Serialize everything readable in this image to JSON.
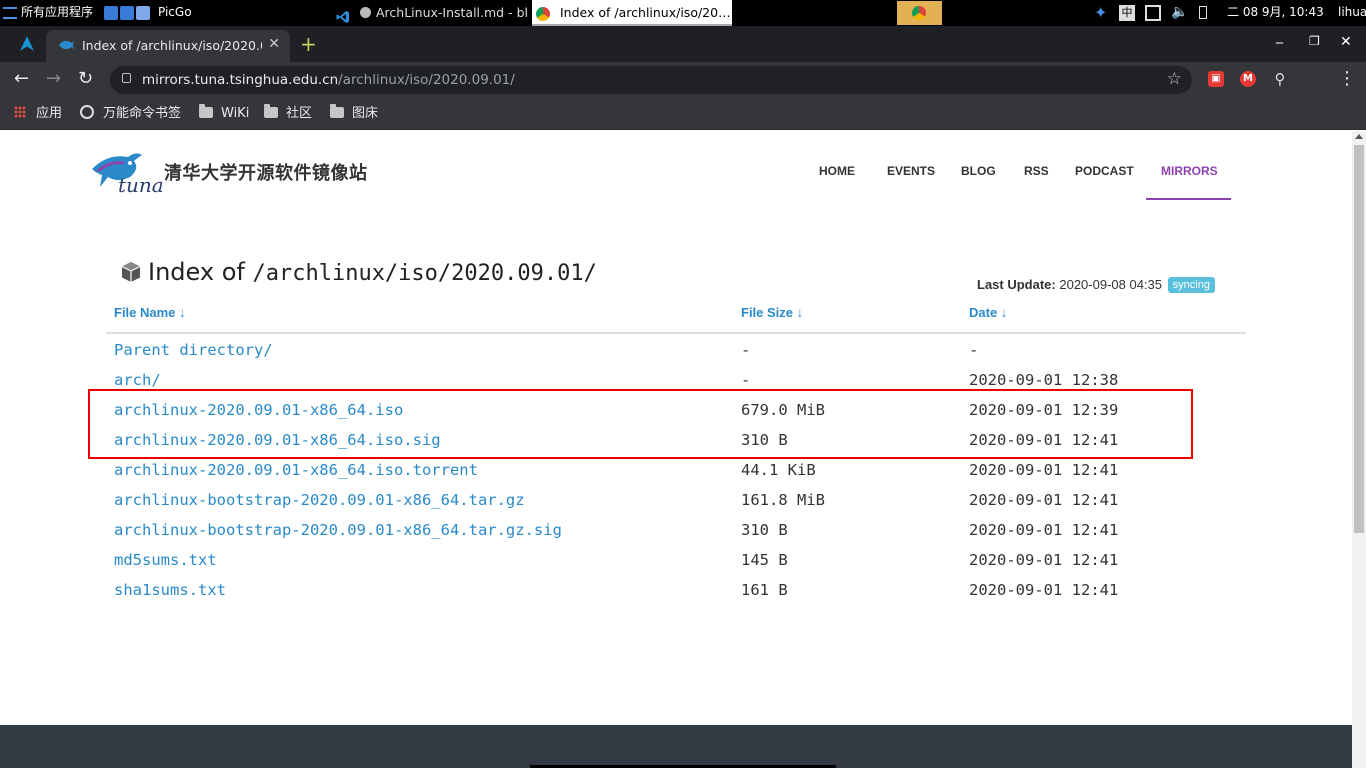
{
  "taskbar": {
    "apps_menu": "所有应用程序",
    "picgo": "PicGo",
    "task_vscode": "ArchLinux-Install.md - bl…",
    "task_chrome": "Index of /archlinux/iso/20…",
    "clock": "二 08 9月, 10:43",
    "user": "lihua"
  },
  "browser": {
    "tab_title": "Index of /archlinux/iso/2020.0",
    "url_host": "mirrors.tuna.tsinghua.edu.cn",
    "url_path": "/archlinux/iso/2020.09.01/",
    "bookmarks": [
      "应用",
      "万能命令书签",
      "WiKi",
      "社区",
      "图床"
    ]
  },
  "site": {
    "brand": "清华大学开源软件镜像站",
    "logo_text": "tuna",
    "menu": [
      "HOME",
      "EVENTS",
      "BLOG",
      "RSS",
      "PODCAST",
      "MIRRORS"
    ],
    "active_menu": "MIRRORS"
  },
  "index": {
    "title_prefix": "Index of",
    "title_path": "/archlinux/iso/2020.09.01/",
    "last_update_label": "Last Update:",
    "last_update_value": "2020-09-08 04:35",
    "status_badge": "syncing",
    "columns": [
      "File Name ↓",
      "File Size ↓",
      "Date ↓"
    ],
    "rows": [
      {
        "name": "Parent directory/",
        "size": "-",
        "date": "-"
      },
      {
        "name": "arch/",
        "size": "-",
        "date": "2020-09-01 12:38"
      },
      {
        "name": "archlinux-2020.09.01-x86_64.iso",
        "size": "679.0 MiB",
        "date": "2020-09-01 12:39"
      },
      {
        "name": "archlinux-2020.09.01-x86_64.iso.sig",
        "size": "310 B",
        "date": "2020-09-01 12:41"
      },
      {
        "name": "archlinux-2020.09.01-x86_64.iso.torrent",
        "size": "44.1 KiB",
        "date": "2020-09-01 12:41"
      },
      {
        "name": "archlinux-bootstrap-2020.09.01-x86_64.tar.gz",
        "size": "161.8 MiB",
        "date": "2020-09-01 12:41"
      },
      {
        "name": "archlinux-bootstrap-2020.09.01-x86_64.tar.gz.sig",
        "size": "310 B",
        "date": "2020-09-01 12:41"
      },
      {
        "name": "md5sums.txt",
        "size": "145 B",
        "date": "2020-09-01 12:41"
      },
      {
        "name": "sha1sums.txt",
        "size": "161 B",
        "date": "2020-09-01 12:41"
      }
    ]
  },
  "colors": {
    "link": "#2a8ac9",
    "active_menu": "#8e44ad",
    "badge": "#5bc0de",
    "highlight_box": "#e00000"
  }
}
